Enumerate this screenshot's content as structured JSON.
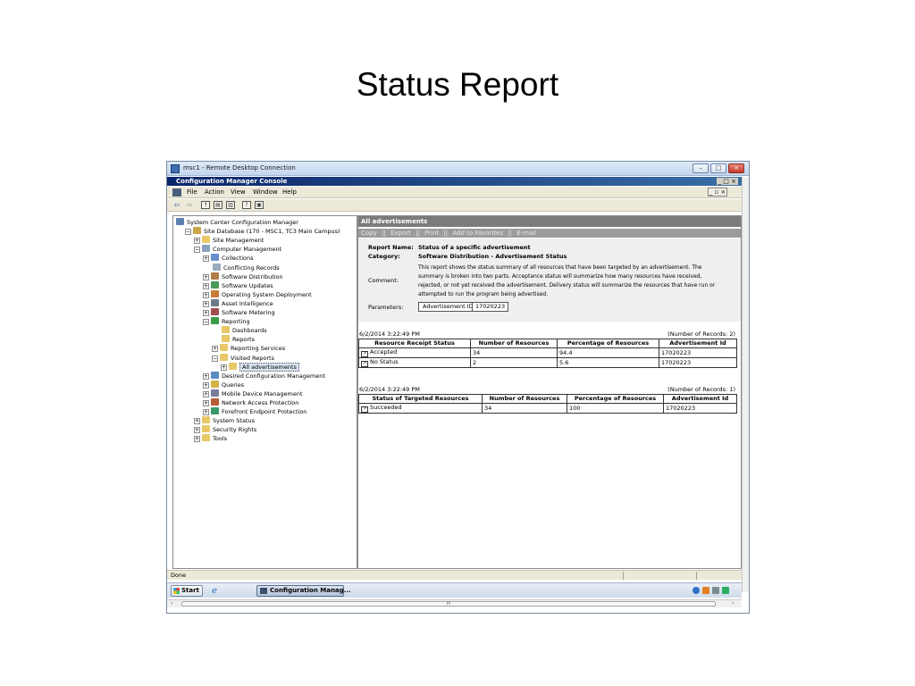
{
  "slide": {
    "title": "Status Report"
  },
  "rdp": {
    "title": "msc1 - Remote Desktop Connection"
  },
  "console": {
    "title": "Configuration Manager Console",
    "window_controls": "_ □ ×"
  },
  "menu": {
    "items": [
      "File",
      "Action",
      "View",
      "Window",
      "Help"
    ],
    "mdi_controls": "_ ▫ ×"
  },
  "tree": {
    "items": [
      {
        "label": "System Center Configuration Manager",
        "indent": 0,
        "exp": "",
        "icon": "console-icon"
      },
      {
        "label": "Site Database  (170 - MSC1, TC3 Main Campus)",
        "indent": 1,
        "exp": "−",
        "icon": "database-icon"
      },
      {
        "label": "Site Management",
        "indent": 2,
        "exp": "+",
        "icon": "folder-icon"
      },
      {
        "label": "Computer Management",
        "indent": 2,
        "exp": "−",
        "icon": "computer-icon"
      },
      {
        "label": "Collections",
        "indent": 3,
        "exp": "+",
        "icon": "collections-icon"
      },
      {
        "label": "Conflicting Records",
        "indent": 3,
        "exp": "",
        "icon": "records-icon"
      },
      {
        "label": "Software Distribution",
        "indent": 3,
        "exp": "+",
        "icon": "package-icon"
      },
      {
        "label": "Software Updates",
        "indent": 3,
        "exp": "+",
        "icon": "updates-icon"
      },
      {
        "label": "Operating System Deployment",
        "indent": 3,
        "exp": "+",
        "icon": "deployment-icon"
      },
      {
        "label": "Asset Intelligence",
        "indent": 3,
        "exp": "+",
        "icon": "asset-icon"
      },
      {
        "label": "Software Metering",
        "indent": 3,
        "exp": "+",
        "icon": "metering-icon"
      },
      {
        "label": "Reporting",
        "indent": 3,
        "exp": "−",
        "icon": "report-icon"
      },
      {
        "label": "Dashboards",
        "indent": 4,
        "exp": "",
        "icon": "folder-icon"
      },
      {
        "label": "Reports",
        "indent": 4,
        "exp": "",
        "icon": "folder-icon"
      },
      {
        "label": "Reporting Services",
        "indent": 4,
        "exp": "+",
        "icon": "folder-icon"
      },
      {
        "label": "Visited Reports",
        "indent": 4,
        "exp": "−",
        "icon": "folder-icon"
      },
      {
        "label": "All advertisements",
        "indent": 5,
        "exp": "+",
        "icon": "folder-icon",
        "selected": true
      },
      {
        "label": "Desired Configuration Management",
        "indent": 3,
        "exp": "+",
        "icon": "dcm-icon"
      },
      {
        "label": "Queries",
        "indent": 3,
        "exp": "+",
        "icon": "query-icon"
      },
      {
        "label": "Mobile Device Management",
        "indent": 3,
        "exp": "+",
        "icon": "mobile-icon"
      },
      {
        "label": "Network Access Protection",
        "indent": 3,
        "exp": "+",
        "icon": "nap-icon"
      },
      {
        "label": "Forefront Endpoint Protection",
        "indent": 3,
        "exp": "+",
        "icon": "shield-icon"
      },
      {
        "label": "System Status",
        "indent": 2,
        "exp": "+",
        "icon": "folder-icon"
      },
      {
        "label": "Security Rights",
        "indent": 2,
        "exp": "+",
        "icon": "folder-icon"
      },
      {
        "label": "Tools",
        "indent": 2,
        "exp": "+",
        "icon": "folder-icon"
      }
    ]
  },
  "report": {
    "header": "All advertisements",
    "links": [
      "Copy",
      "||",
      "Export",
      "||",
      "Print",
      "||",
      "Add to Favorites",
      "||",
      "E-mail"
    ],
    "name_label": "Report Name:",
    "name_value": "Status of a specific advertisement",
    "category_label": "Category:",
    "category_value": "Software Distribution - Advertisement Status",
    "comment_label": "Comment:",
    "comment_lines": [
      "This report shows the status summary of all resources that have been targeted by an advertisement. The",
      "summary is broken into two parts. Acceptance status will summarize how many resources have received,",
      "rejected, or not yet received the advertisement. Delivery status will summarize the resources that have run or",
      "attempted to run the program being advertised."
    ],
    "params_label": "Parameters:",
    "param_name": "Advertisement ID",
    "param_value": "17020223"
  },
  "table1": {
    "timestamp": "6/2/2014 3:22:49 PM",
    "records": "(Number of Records: 2)",
    "headers": [
      "Resource Receipt Status",
      "Number of Resources",
      "Percentage of Resources",
      "Advertisement Id"
    ],
    "rows": [
      [
        "Accepted",
        "34",
        "94.4",
        "17020223"
      ],
      [
        "No Status",
        "2",
        "5.6",
        "17020223"
      ]
    ]
  },
  "table2": {
    "timestamp": "6/2/2014 3:22:49 PM",
    "records": "(Number of Records: 1)",
    "headers": [
      "Status of Targeted Resources",
      "Number of Resources",
      "Percentage of Resources",
      "Advertisement Id"
    ],
    "rows": [
      [
        "Succeeded",
        "34",
        "100",
        "17020223"
      ]
    ]
  },
  "status_bar": {
    "text": "Done"
  },
  "taskbar": {
    "start": "Start",
    "task": "Configuration Manag..."
  },
  "scrollbar": {
    "thumb_grip": "III"
  },
  "colors": {
    "selection": "#d9e4f2",
    "report_header": "#7b7b7b",
    "title_bar": "#0a246a"
  }
}
